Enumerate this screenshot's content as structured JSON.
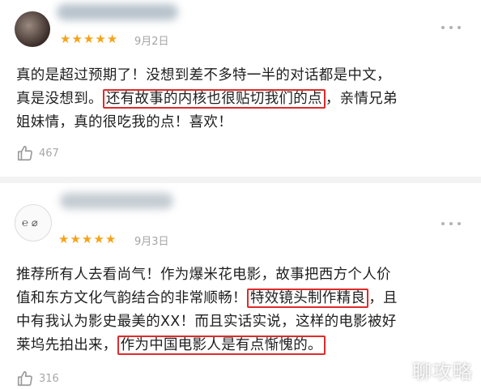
{
  "reviews": [
    {
      "rating": 5,
      "date": "9月2日",
      "lines": [
        {
          "pre": "真的是超过预期了！没想到差不多特一半的对话都是中文，",
          "hl": "",
          "post": ""
        },
        {
          "pre": "真是没想到。",
          "hl": "还有故事的内核也很贴切我们的点",
          "post": "，亲情兄弟"
        },
        {
          "pre": "姐妹情，真的很吃我的点！喜欢！",
          "hl": "",
          "post": ""
        }
      ],
      "likes": "467"
    },
    {
      "rating": 5,
      "date": "9月3日",
      "lines": [
        {
          "pre": "推荐所有人去看尚气！作为爆米花电影，故事把西方个人价",
          "hl": "",
          "post": ""
        },
        {
          "pre": "值和东方文化气韵结合的非常顺畅！",
          "hl": "特效镜头制作精良",
          "post": "，且"
        },
        {
          "pre": "中有我认为影史最美的XX！而且实话实说，这样的电影被好",
          "hl": "",
          "post": ""
        },
        {
          "pre": "莱坞先拍出来，",
          "hl": "作为中国电影人是有点惭愧的。",
          "post": ""
        }
      ],
      "likes": "316"
    }
  ],
  "icons": {
    "star": "star-icon",
    "like": "thumbs-up-icon",
    "more": "more-dots-icon"
  },
  "colors": {
    "star": "#f5a31a",
    "highlight_box": "#e02a2a",
    "muted": "#a8a8a8"
  },
  "watermark": "聊攻略"
}
